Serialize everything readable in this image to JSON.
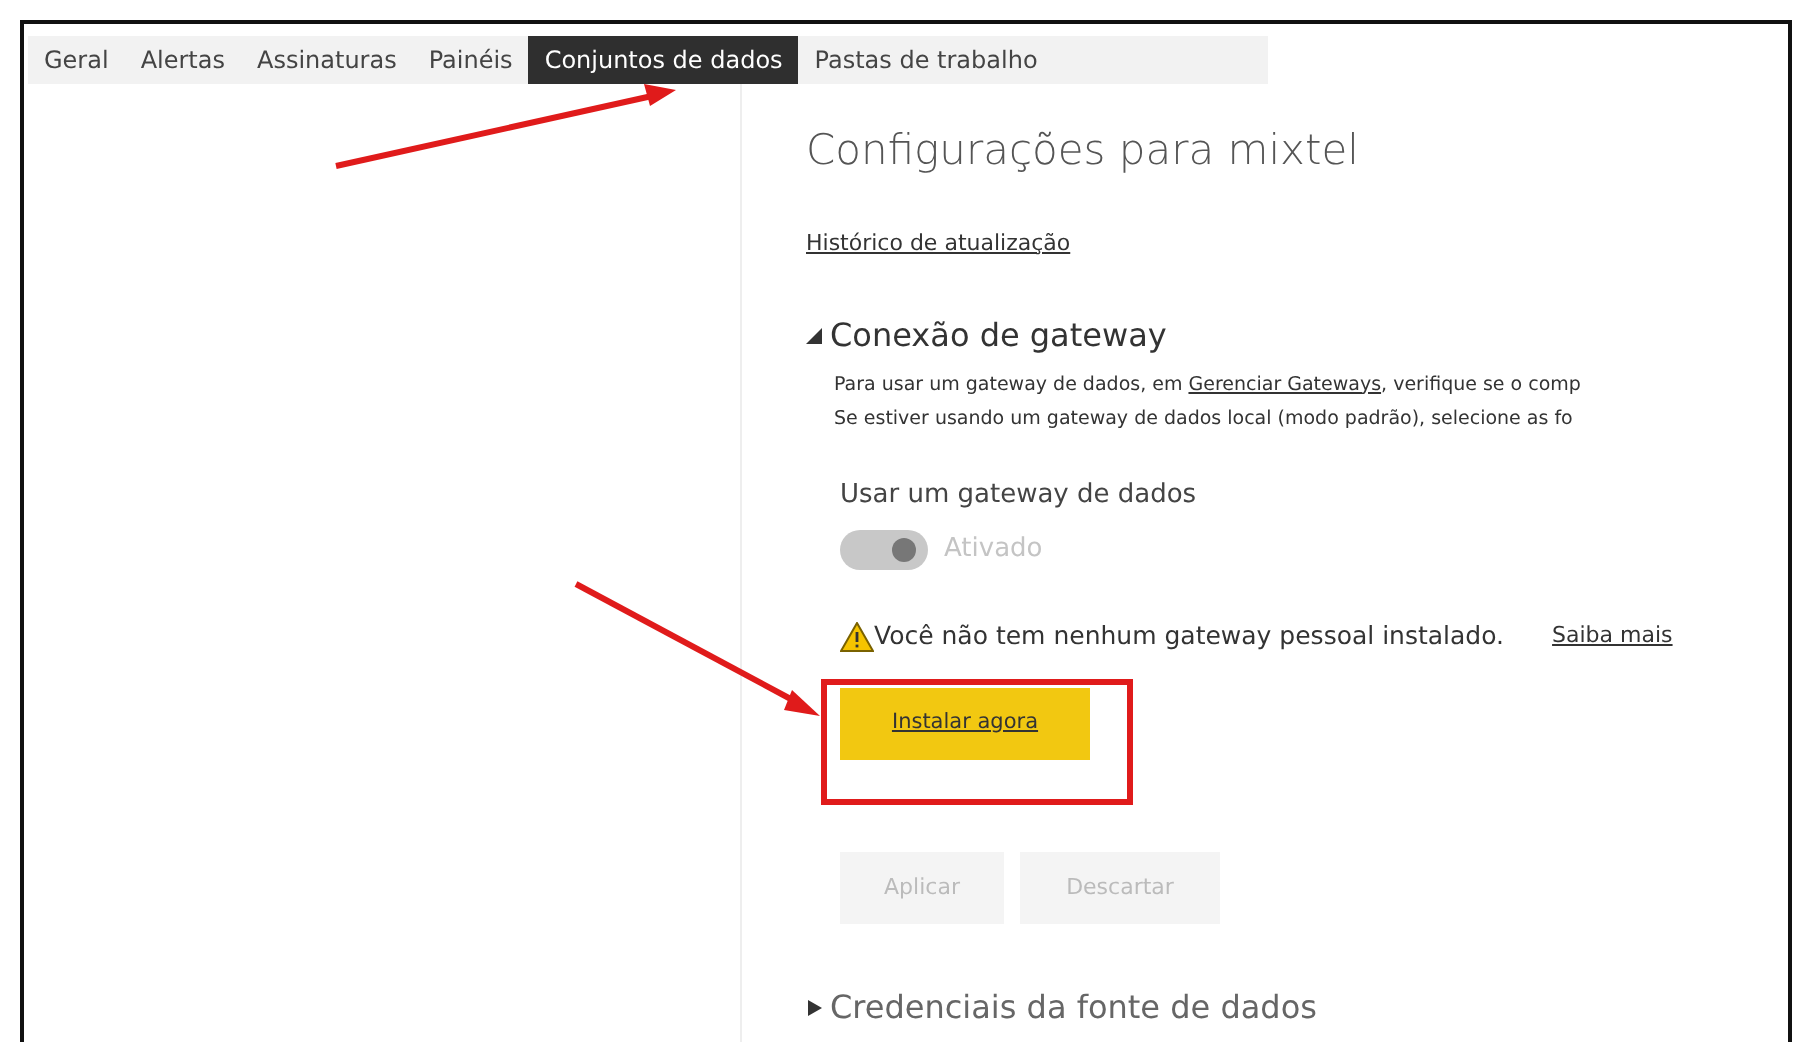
{
  "tabs": [
    {
      "label": "Geral",
      "selected": false
    },
    {
      "label": "Alertas",
      "selected": false
    },
    {
      "label": "Assinaturas",
      "selected": false
    },
    {
      "label": "Painéis",
      "selected": false
    },
    {
      "label": "Conjuntos de dados",
      "selected": true
    },
    {
      "label": "Pastas de trabalho",
      "selected": false
    }
  ],
  "settings": {
    "title": "Configurações para mixtel",
    "history_link": "Histórico de atualização",
    "gateway_section": {
      "title": "Conexão de gateway",
      "expanded": true,
      "description": [
        {
          "before": "Para usar um gateway de dados, em ",
          "link": "Gerenciar Gateways",
          "after": ", verifique se o comp"
        },
        {
          "before": "Se estiver usando um gateway de dados local (modo padrão), selecione as fo"
        }
      ],
      "toggle": {
        "label": "Usar um gateway de dados",
        "on": true,
        "disabled": true,
        "state_text": "Ativado"
      },
      "warning": {
        "text": "Você não tem nenhum gateway pessoal instalado.",
        "link": "Saiba mais"
      },
      "install_button": "Instalar agora"
    },
    "buttons": [
      {
        "label": "Aplicar",
        "disabled": true
      },
      {
        "label": "Descartar",
        "disabled": true
      }
    ],
    "credentials_section": {
      "title": "Credenciais da fonte de dados",
      "expanded": false
    }
  }
}
